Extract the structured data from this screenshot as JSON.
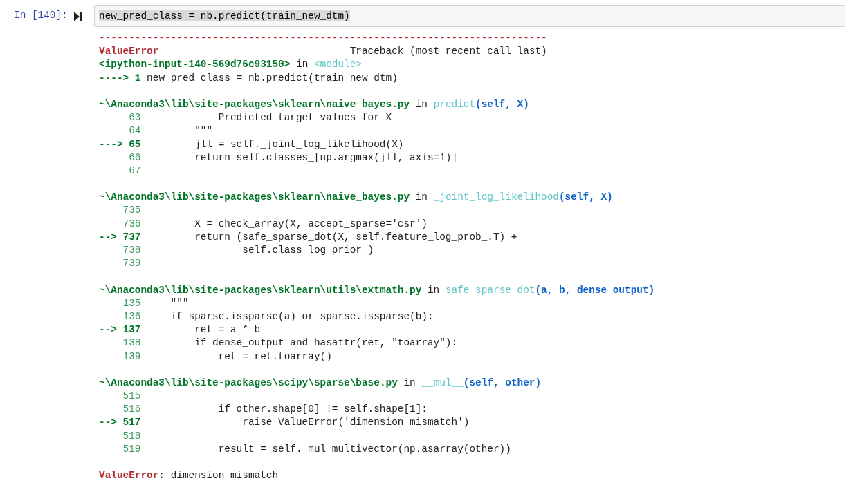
{
  "cell": {
    "prompt": "In [140]:",
    "code": "new_pred_class = nb.predict(train_new_dtm)",
    "highlighted": true
  },
  "output": {
    "separator": "---------------------------------------------------------------------------",
    "error_name": "ValueError",
    "traceback_label": "Traceback (most recent call last)",
    "source": "<ipython-input-140-569d76c93150>",
    "in_word": "in",
    "scope": "<module>",
    "entry_line": {
      "arrow": "---->",
      "number": "1",
      "code": "new_pred_class = nb.predict(train_new_dtm)"
    },
    "frames": [
      {
        "path": "~\\Anaconda3\\lib\\site-packages\\sklearn\\naive_bayes.py",
        "in_word": "in",
        "function": "predict",
        "args": "(self, X)",
        "lines": [
          {
            "number": "63",
            "code": "             Predicted target values for X",
            "current": false
          },
          {
            "number": "64",
            "code": "         \"\"\"",
            "current": false
          },
          {
            "arrow": "--->",
            "number": "65",
            "code": "         jll = self._joint_log_likelihood(X)",
            "current": true
          },
          {
            "number": "66",
            "code": "         return self.classes_[np.argmax(jll, axis=1)]",
            "current": false
          },
          {
            "number": "67",
            "current": false
          }
        ]
      },
      {
        "path": "~\\Anaconda3\\lib\\site-packages\\sklearn\\naive_bayes.py",
        "in_word": "in",
        "function": "_joint_log_likelihood",
        "args": "(self, X)",
        "lines": [
          {
            "number": "735",
            "current": false
          },
          {
            "number": "736",
            "code": "         X = check_array(X, accept_sparse='csr')",
            "current": false
          },
          {
            "arrow": "-->",
            "number": "737",
            "code": "         return (safe_sparse_dot(X, self.feature_log_prob_.T) +",
            "current": true
          },
          {
            "number": "738",
            "code": "                 self.class_log_prior_)",
            "current": false
          },
          {
            "number": "739",
            "current": false
          }
        ]
      },
      {
        "path": "~\\Anaconda3\\lib\\site-packages\\sklearn\\utils\\extmath.py",
        "in_word": "in",
        "function": "safe_sparse_dot",
        "args": "(a, b, dense_output)",
        "lines": [
          {
            "number": "135",
            "code": "     \"\"\"",
            "current": false
          },
          {
            "number": "136",
            "code": "     if sparse.issparse(a) or sparse.issparse(b):",
            "current": false
          },
          {
            "arrow": "-->",
            "number": "137",
            "code": "         ret = a * b",
            "current": true
          },
          {
            "number": "138",
            "code": "         if dense_output and hasattr(ret, \"toarray\"):",
            "current": false
          },
          {
            "number": "139",
            "code": "             ret = ret.toarray()",
            "current": false
          }
        ]
      },
      {
        "path": "~\\Anaconda3\\lib\\site-packages\\scipy\\sparse\\base.py",
        "in_word": "in",
        "function": "__mul__",
        "args": "(self, other)",
        "lines": [
          {
            "number": "515",
            "current": false
          },
          {
            "number": "516",
            "code": "             if other.shape[0] != self.shape[1]:",
            "current": false
          },
          {
            "arrow": "-->",
            "number": "517",
            "code": "                 raise ValueError('dimension mismatch')",
            "current": true
          },
          {
            "number": "518",
            "current": false
          },
          {
            "number": "519",
            "code": "             result = self._mul_multivector(np.asarray(other))",
            "current": false
          }
        ]
      }
    ],
    "final": {
      "error_name": "ValueError",
      "message": ": dimension mismatch"
    }
  }
}
